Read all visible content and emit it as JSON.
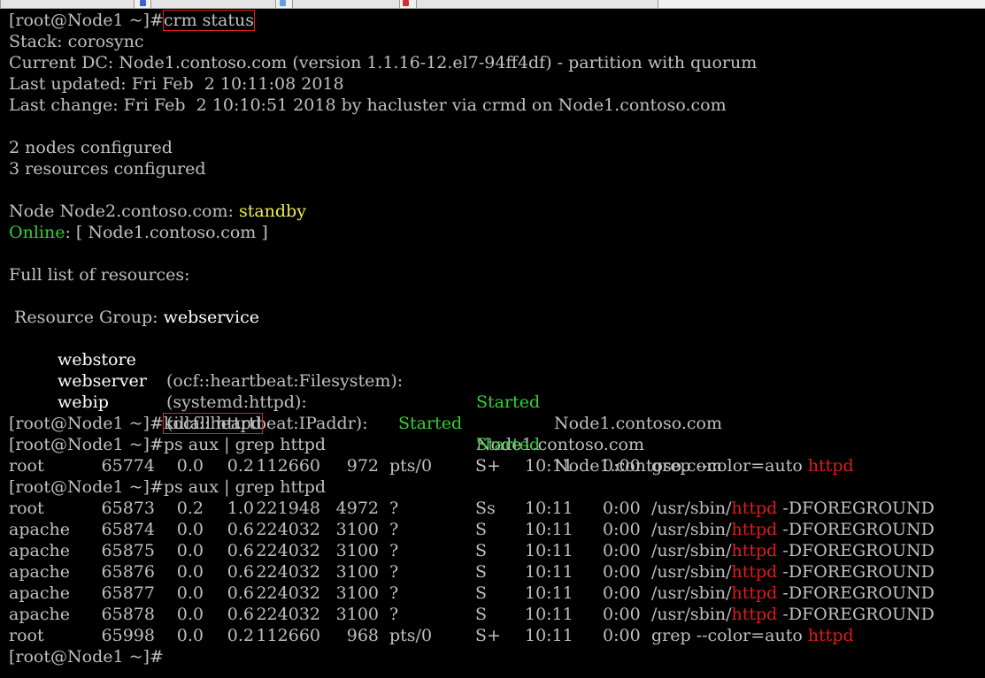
{
  "prompt": "[root@Node1 ~]#",
  "cmd_crm_status": "crm status",
  "stack": "Stack: corosync",
  "current_dc": "Current DC: Node1.contoso.com (version 1.1.16-12.el7-94ff4df) - partition with quorum",
  "last_updated": "Last updated: Fri Feb  2 10:11:08 2018",
  "last_change": "Last change: Fri Feb  2 10:10:51 2018 by hacluster via crmd on Node1.contoso.com",
  "nodes_configured": "2 nodes configured",
  "resources_configured": "3 resources configured",
  "node_label": "Node Node2.contoso.com: ",
  "node_state": "standby",
  "online_label": "Online",
  "online_value": ": [ Node1.contoso.com ]",
  "full_list": "Full list of resources:",
  "resource_group_label": " Resource Group: ",
  "resource_group_name": "webservice",
  "resources": [
    {
      "name": "webstore",
      "agent": "(ocf::heartbeat:Filesystem):",
      "status": "Started",
      "node": "Node1.contoso.com"
    },
    {
      "name": "webserver",
      "agent": "(systemd:httpd):",
      "status": "Started",
      "node": "Node1.contoso.com"
    },
    {
      "name": "webip",
      "agent": "(ocf::heartbeat:IPaddr):",
      "status": "Started",
      "node": "Node1.contoso.com"
    }
  ],
  "cmd_killall": "killall httpd",
  "cmd_ps": "ps aux | grep httpd",
  "ps_first": [
    {
      "user": "root",
      "pid": "65774",
      "cpu": "0.0",
      "mem": "0.2",
      "vsz": "112660",
      "rss": "972",
      "tty": "pts/0",
      "stat": "S+",
      "start": "10:11",
      "time": "0:00",
      "cmd_pre": "grep --color=auto ",
      "cmd_match": "httpd",
      "cmd_post": ""
    }
  ],
  "ps_second": [
    {
      "user": "root",
      "pid": "65873",
      "cpu": "0.2",
      "mem": "1.0",
      "vsz": "221948",
      "rss": "4972",
      "tty": "?",
      "stat": "Ss",
      "start": "10:11",
      "time": "0:00",
      "cmd_pre": "/usr/sbin/",
      "cmd_match": "httpd",
      "cmd_post": " -DFOREGROUND"
    },
    {
      "user": "apache",
      "pid": "65874",
      "cpu": "0.0",
      "mem": "0.6",
      "vsz": "224032",
      "rss": "3100",
      "tty": "?",
      "stat": "S",
      "start": "10:11",
      "time": "0:00",
      "cmd_pre": "/usr/sbin/",
      "cmd_match": "httpd",
      "cmd_post": " -DFOREGROUND"
    },
    {
      "user": "apache",
      "pid": "65875",
      "cpu": "0.0",
      "mem": "0.6",
      "vsz": "224032",
      "rss": "3100",
      "tty": "?",
      "stat": "S",
      "start": "10:11",
      "time": "0:00",
      "cmd_pre": "/usr/sbin/",
      "cmd_match": "httpd",
      "cmd_post": " -DFOREGROUND"
    },
    {
      "user": "apache",
      "pid": "65876",
      "cpu": "0.0",
      "mem": "0.6",
      "vsz": "224032",
      "rss": "3100",
      "tty": "?",
      "stat": "S",
      "start": "10:11",
      "time": "0:00",
      "cmd_pre": "/usr/sbin/",
      "cmd_match": "httpd",
      "cmd_post": " -DFOREGROUND"
    },
    {
      "user": "apache",
      "pid": "65877",
      "cpu": "0.0",
      "mem": "0.6",
      "vsz": "224032",
      "rss": "3100",
      "tty": "?",
      "stat": "S",
      "start": "10:11",
      "time": "0:00",
      "cmd_pre": "/usr/sbin/",
      "cmd_match": "httpd",
      "cmd_post": " -DFOREGROUND"
    },
    {
      "user": "apache",
      "pid": "65878",
      "cpu": "0.0",
      "mem": "0.6",
      "vsz": "224032",
      "rss": "3100",
      "tty": "?",
      "stat": "S",
      "start": "10:11",
      "time": "0:00",
      "cmd_pre": "/usr/sbin/",
      "cmd_match": "httpd",
      "cmd_post": " -DFOREGROUND"
    },
    {
      "user": "root",
      "pid": "65998",
      "cpu": "0.0",
      "mem": "0.2",
      "vsz": "112660",
      "rss": "968",
      "tty": "pts/0",
      "stat": "S+",
      "start": "10:11",
      "time": "0:00",
      "cmd_pre": "grep --color=auto ",
      "cmd_match": "httpd",
      "cmd_post": ""
    }
  ],
  "colors": {
    "background": "#000000",
    "text": "#c0c0c0",
    "highlight_box": "#e02020",
    "match_red": "#e01b1b",
    "started_green": "#35d035",
    "standby_yellow": "#f0f050"
  },
  "icons": [
    "window-tab-icon",
    "terminal-tab-icon",
    "close-tab-icon"
  ]
}
